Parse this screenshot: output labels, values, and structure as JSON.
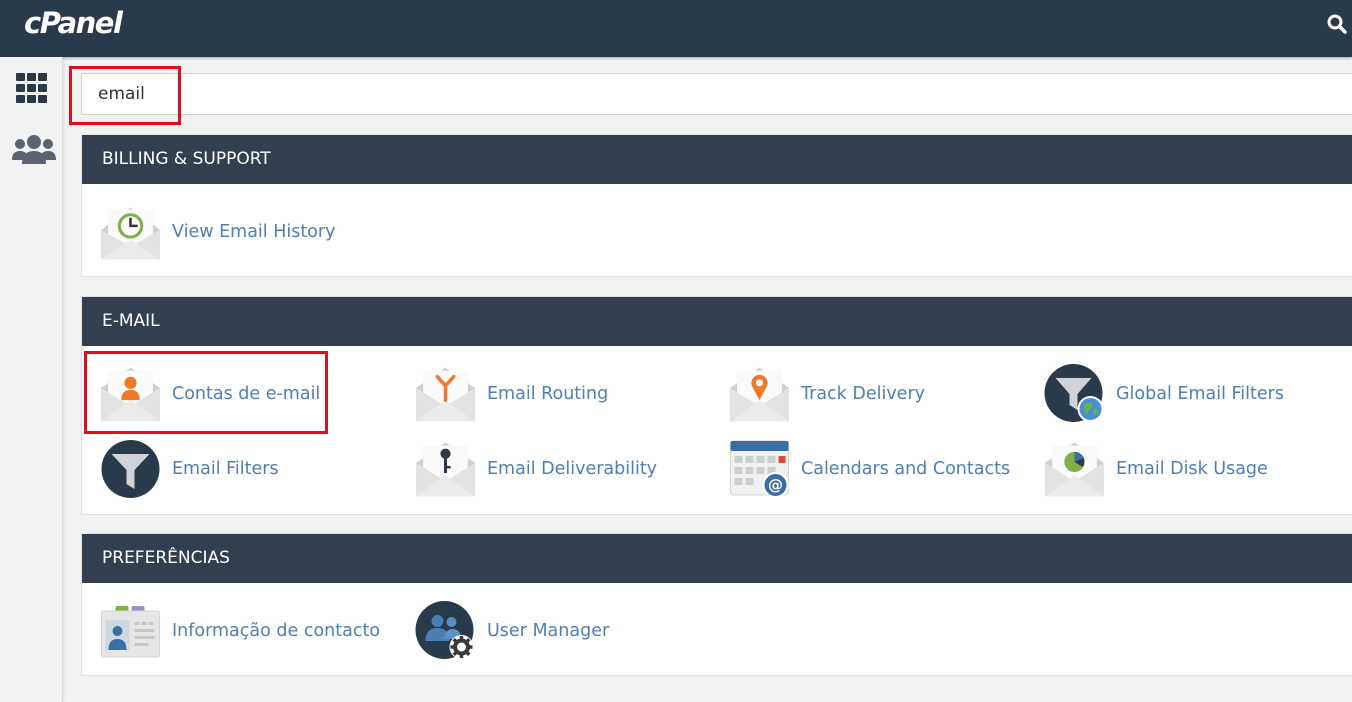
{
  "header": {
    "logo": "cPanel"
  },
  "search": {
    "value": "email"
  },
  "sections": {
    "billing": {
      "title": "BILLING & SUPPORT",
      "items": [
        {
          "label": "View Email History",
          "icon": "email-history-icon"
        }
      ]
    },
    "email": {
      "title": "E-MAIL",
      "items": [
        {
          "label": "Contas de e-mail",
          "icon": "email-accounts-icon"
        },
        {
          "label": "Email Routing",
          "icon": "email-routing-icon"
        },
        {
          "label": "Track Delivery",
          "icon": "track-delivery-icon"
        },
        {
          "label": "Global Email Filters",
          "icon": "global-email-filters-icon"
        },
        {
          "label": "Email Filters",
          "icon": "email-filters-icon"
        },
        {
          "label": "Email Deliverability",
          "icon": "email-deliverability-icon"
        },
        {
          "label": "Calendars and Contacts",
          "icon": "calendars-contacts-icon"
        },
        {
          "label": "Email Disk Usage",
          "icon": "email-disk-usage-icon"
        }
      ]
    },
    "preferences": {
      "title": "PREFERÊNCIAS",
      "items": [
        {
          "label": "Informação de contacto",
          "icon": "contact-info-icon"
        },
        {
          "label": "User Manager",
          "icon": "user-manager-icon"
        }
      ]
    }
  },
  "colors": {
    "topbar": "#293a4a",
    "section_header": "#333f4e",
    "link": "#4e7fb5",
    "highlight": "#e0101a"
  }
}
